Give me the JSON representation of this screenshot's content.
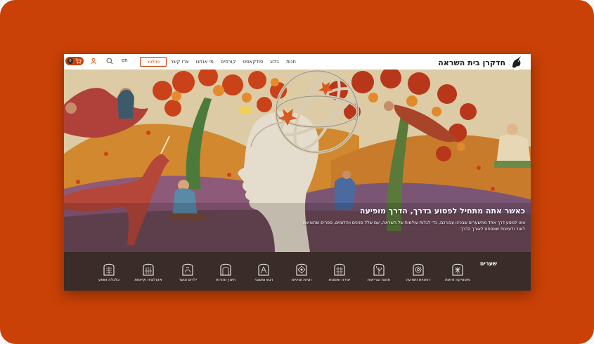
{
  "header": {
    "logo_text": "חדקרן בית השראה",
    "nav": [
      "חנות",
      "בלוג",
      "פודקאסט",
      "קורסים",
      "מי אנחנו",
      "צרו קשר"
    ],
    "newsletter_label": "ניוזלטר",
    "language": "en",
    "cart_count": "0"
  },
  "hero": {
    "title": "כאשר אתה מתחיל לפסוע בדרך, הדרך מופיעה",
    "body": "צאו למסע דרך אחד מהשערים שבכינו עבורכם, כדי לגלות עולמות של השראה, עם שלל פנינים ויהלומים, ספרים שהוציאנו לאור ודעיונות שאספנו לאורך הדרך."
  },
  "gates": {
    "title": "שערים",
    "items": [
      {
        "label": "מיסטיקה ודתות"
      },
      {
        "label": "רוחניות ותודעה"
      },
      {
        "label": "תזונה ובריאות"
      },
      {
        "label": "יצירה ואמנות"
      },
      {
        "label": "זוגיות ומיניות"
      },
      {
        "label": "רגש ומשבר"
      },
      {
        "label": "חינוך והורות"
      },
      {
        "label": "ילדים ונוער"
      },
      {
        "label": "אקולוגיה וקיימות"
      },
      {
        "label": "כלכלה ושפע"
      }
    ]
  },
  "colors": {
    "brand": "#c94106",
    "bar": "#3a2c28"
  }
}
